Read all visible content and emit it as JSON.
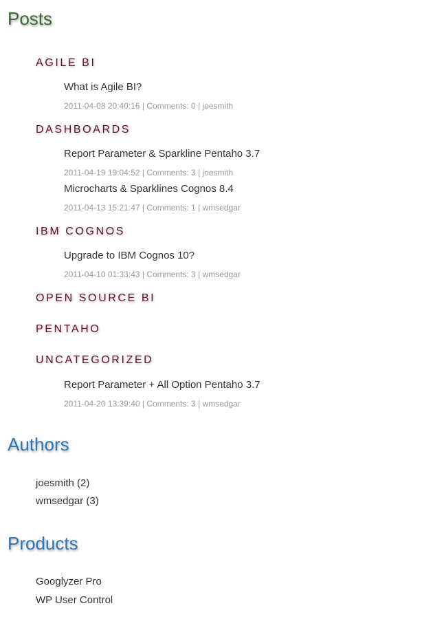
{
  "posts": {
    "title": "Posts",
    "categories": [
      {
        "name": "AGILE BI",
        "posts": [
          {
            "title": "What is Agile BI?",
            "date": "2011-04-08 20:40:16",
            "comments": "Comments: 0",
            "author": "joesmith"
          }
        ]
      },
      {
        "name": "DASHBOARDS",
        "posts": [
          {
            "title": "Report Parameter & Sparkline Pentaho 3.7",
            "date": "2011-04-19 19:04:52",
            "comments": "Comments: 3",
            "author": "joesmith"
          },
          {
            "title": "Microcharts & Sparklines Cognos 8.4",
            "date": "2011-04-13 15:21:47",
            "comments": "Comments: 1",
            "author": "wmsedgar"
          }
        ]
      },
      {
        "name": "IBM COGNOS",
        "posts": [
          {
            "title": "Upgrade to IBM Cognos 10?",
            "date": "2011-04-10 01:33:43",
            "comments": "Comments: 3",
            "author": "wmsedgar"
          }
        ]
      },
      {
        "name": "OPEN SOURCE BI",
        "posts": []
      },
      {
        "name": "PENTAHO",
        "posts": []
      },
      {
        "name": "UNCATEGORIZED",
        "posts": [
          {
            "title": "Report Parameter + All Option Pentaho 3.7",
            "date": "2011-04-20 13:39:40",
            "comments": "Comments: 3",
            "author": "wmsedgar"
          }
        ]
      }
    ]
  },
  "authors": {
    "title": "Authors",
    "items": [
      {
        "name": "joesmith",
        "count": "(2)"
      },
      {
        "name": "wmsedgar",
        "count": "(3)"
      }
    ]
  },
  "products": {
    "title": "Products",
    "items": [
      {
        "name": "Googlyzer Pro"
      },
      {
        "name": "WP User Control"
      }
    ]
  },
  "separator": "|",
  "colors": {
    "posts_title": "#3a6a35",
    "section_title": "#2e76b8",
    "category": "#6a0f33",
    "meta": "#999999",
    "text": "#333333"
  }
}
